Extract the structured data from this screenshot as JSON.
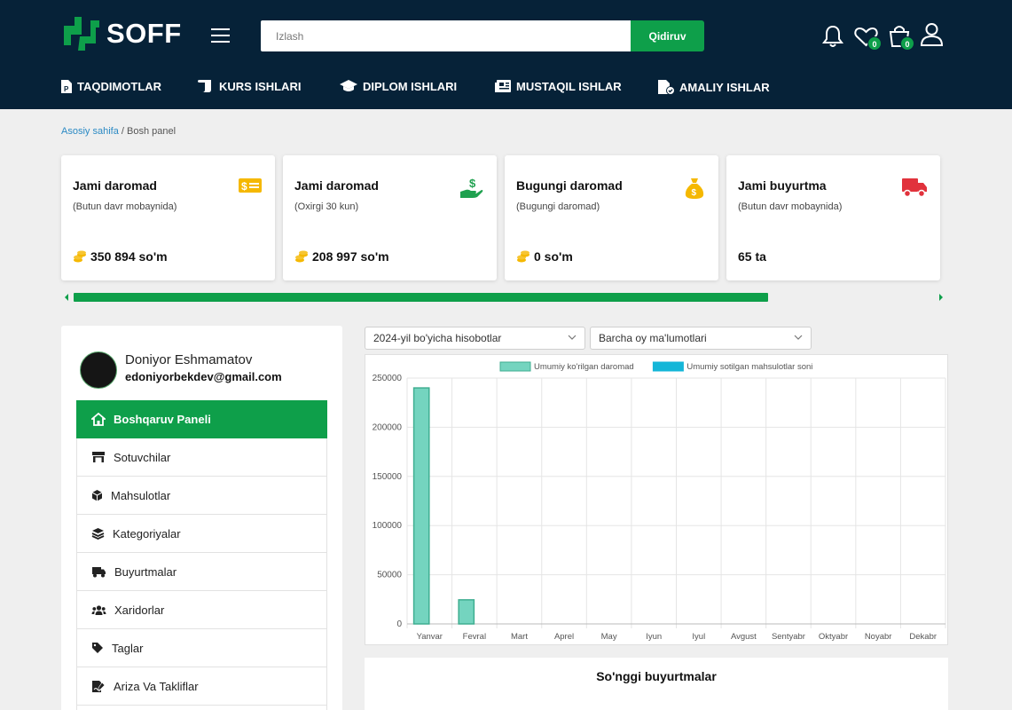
{
  "header": {
    "logo_text": "SOFF",
    "search_placeholder": "Izlash",
    "search_button": "Qidiruv",
    "wishlist_count": "0",
    "cart_count": "0",
    "colors": {
      "bg": "#062238",
      "accent": "#0e9f4a"
    }
  },
  "nav": {
    "items": [
      {
        "label": "TAQDIMOTLAR",
        "icon": "presentation-file-icon"
      },
      {
        "label": "KURS ISHLARI",
        "icon": "scroll-icon"
      },
      {
        "label": "DIPLOM ISHLARI",
        "icon": "graduation-cap-icon"
      },
      {
        "label": "MUSTAQIL ISHLAR",
        "icon": "newspaper-icon"
      },
      {
        "label": "AMALIY ISHLAR",
        "icon": "checked-file-icon"
      }
    ]
  },
  "breadcrumb": {
    "home": "Asosiy sahifa",
    "separator": "/",
    "current": "Bosh panel"
  },
  "cards": [
    {
      "title": "Jami daromad",
      "subtitle": "(Butun davr mobaynida)",
      "value": "350 894 so'm",
      "icon": "money-bill-icon"
    },
    {
      "title": "Jami daromad",
      "subtitle": "(Oxirgi 30 kun)",
      "value": "208 997 so'm",
      "icon": "hand-dollar-icon"
    },
    {
      "title": "Bugungi daromad",
      "subtitle": "(Bugungi daromad)",
      "value": "0 so'm",
      "icon": "money-bag-icon"
    },
    {
      "title": "Jami buyurtma",
      "subtitle": "(Butun davr mobaynida)",
      "value": "65 ta",
      "icon": "truck-icon"
    }
  ],
  "user": {
    "name": "Doniyor Eshmamatov",
    "email": "edoniyorbekdev@gmail.com"
  },
  "menu": [
    {
      "label": "Boshqaruv Paneli",
      "icon": "home-icon",
      "active": true
    },
    {
      "label": "Sotuvchilar",
      "icon": "store-icon"
    },
    {
      "label": "Mahsulotlar",
      "icon": "box-icon"
    },
    {
      "label": "Kategoriyalar",
      "icon": "layers-icon"
    },
    {
      "label": "Buyurtmalar",
      "icon": "truck-icon"
    },
    {
      "label": "Xaridorlar",
      "icon": "users-icon"
    },
    {
      "label": "Taglar",
      "icon": "tag-icon"
    },
    {
      "label": "Ariza Va Takliflar",
      "icon": "signature-icon"
    }
  ],
  "filters": {
    "year": "2024-yil bo'yicha hisobotlar",
    "month": "Barcha oy ma'lumotlari"
  },
  "chart_data": {
    "type": "bar",
    "categories": [
      "Yanvar",
      "Fevral",
      "Mart",
      "Aprel",
      "May",
      "Iyun",
      "Iyul",
      "Avgust",
      "Sentyabr",
      "Oktyabr",
      "Noyabr",
      "Dekabr"
    ],
    "series": [
      {
        "name": "Umumiy ko'rilgan daromad",
        "color": "#74d4bf",
        "border": "#3fae91",
        "values": [
          240000,
          24500,
          0,
          0,
          0,
          0,
          0,
          0,
          0,
          0,
          0,
          0
        ]
      },
      {
        "name": "Umumiy sotilgan mahsulotlar soni",
        "color": "#14b6d8",
        "border": "#14b6d8",
        "values": [
          0,
          0,
          0,
          0,
          0,
          0,
          0,
          0,
          0,
          0,
          0,
          0
        ]
      }
    ],
    "ylim": [
      0,
      250000
    ],
    "yticks": [
      "0",
      "50000",
      "100000",
      "150000",
      "200000",
      "250000"
    ],
    "legend": "top-center",
    "grid": true
  },
  "orders": {
    "title": "So'nggi buyurtmalar"
  }
}
